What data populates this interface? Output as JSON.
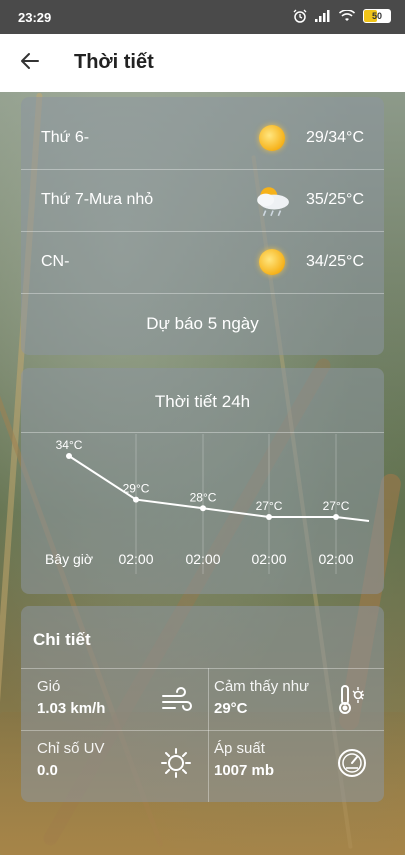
{
  "status_bar": {
    "time": "23:29",
    "battery": "50",
    "battery_level": 0.5
  },
  "app_bar": {
    "title": "Thời tiết"
  },
  "daily": [
    {
      "day": "Thứ 6-",
      "icon": "sun-icon",
      "temp": "29/34°C"
    },
    {
      "day": "Thứ 7-Mưa nhỏ",
      "icon": "sun-cloud-rain-icon",
      "temp": "35/25°C"
    },
    {
      "day": "CN-",
      "icon": "sun-icon",
      "temp": "34/25°C"
    }
  ],
  "forecast_button": "Dự báo 5 ngày",
  "hourly": {
    "title": "Thời tiết 24h",
    "chart_data": {
      "type": "line",
      "x": [
        "Bây giờ",
        "02:00",
        "02:00",
        "02:00",
        "02:00"
      ],
      "values": [
        34,
        29,
        28,
        27,
        27
      ],
      "labels": [
        "34°C",
        "29°C",
        "28°C",
        "27°C",
        "27°C"
      ]
    }
  },
  "details": {
    "title": "Chi tiết",
    "items": [
      {
        "label": "Gió",
        "value": "1.03 km/h",
        "icon": "wind-icon"
      },
      {
        "label": "Cảm thấy như",
        "value": "29°C",
        "icon": "thermometer-sun-icon"
      },
      {
        "label": "Chỉ số UV",
        "value": "0.0",
        "icon": "uv-sun-icon"
      },
      {
        "label": "Áp suất",
        "value": "1007 mb",
        "icon": "gauge-icon"
      }
    ]
  }
}
